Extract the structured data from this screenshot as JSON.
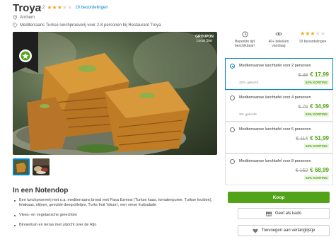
{
  "deal": {
    "title": "Troya",
    "rating": "3.2",
    "stars_filled": 3,
    "stars_total": 5,
    "reviews": "19 beoordelingen",
    "location": "Arnhem",
    "description": "Mediterraans Turkse lunchproeverij voor 2-8 personen bij Restaurant Troya"
  },
  "badge": {
    "line1": "GROUPON",
    "line2": "Local Star"
  },
  "stats": [
    {
      "icon": "clock-icon",
      "label": "Beperkte tijd beschikbaar!"
    },
    {
      "icon": "eye-icon",
      "label": "40+ bekeken vandaag"
    },
    {
      "icon": "stars-icon",
      "label": "19 beoordelingen"
    }
  ],
  "options": [
    {
      "label": "Mediterraanse lunchtafel voor 2 personen",
      "sold": "320+ gekocht",
      "old_price": "€ 38",
      "new_price": "€ 17,99",
      "discount": "52% KORTING",
      "selected": true
    },
    {
      "label": "Mediterraanse lunchtafel voor 4 personen",
      "sold": "30+ gekocht",
      "old_price": "€ 76",
      "new_price": "€ 34,99",
      "discount": "53% KORTING",
      "selected": false
    },
    {
      "label": "Mediterraanse lunchtafel voor 6 personen",
      "sold": "",
      "old_price": "€ 114",
      "new_price": "€ 51,99",
      "discount": "54% KORTING",
      "selected": false
    },
    {
      "label": "Mediterraanse lunchtafel voor 8 personen",
      "sold": "",
      "old_price": "€ 152",
      "new_price": "€ 68,99",
      "discount": "54% KORTING",
      "selected": false
    }
  ],
  "buttons": {
    "buy": "Koop",
    "gift": "Geef als kado",
    "wishlist": "Toevoegen aan verlanglijstje"
  },
  "overview": {
    "title": "In een Notendop",
    "bullets": [
      "Een lunchproeverij met o.a. mediterraans brood met Pasa Ezmesi (Turkse kaas, tomatenpuree, Turkse kruiden), fetakaas, olijven, gevulde deegrolletjes, Turks fruit 'lokum', een verse fruitsalade",
      "Vlees- en vegetarische gerechten",
      "Binnentuin en terras met uitzicht over de Rijn"
    ]
  },
  "colors": {
    "accent": "#0185c6",
    "green": "#53a318",
    "star": "#f5a623"
  }
}
